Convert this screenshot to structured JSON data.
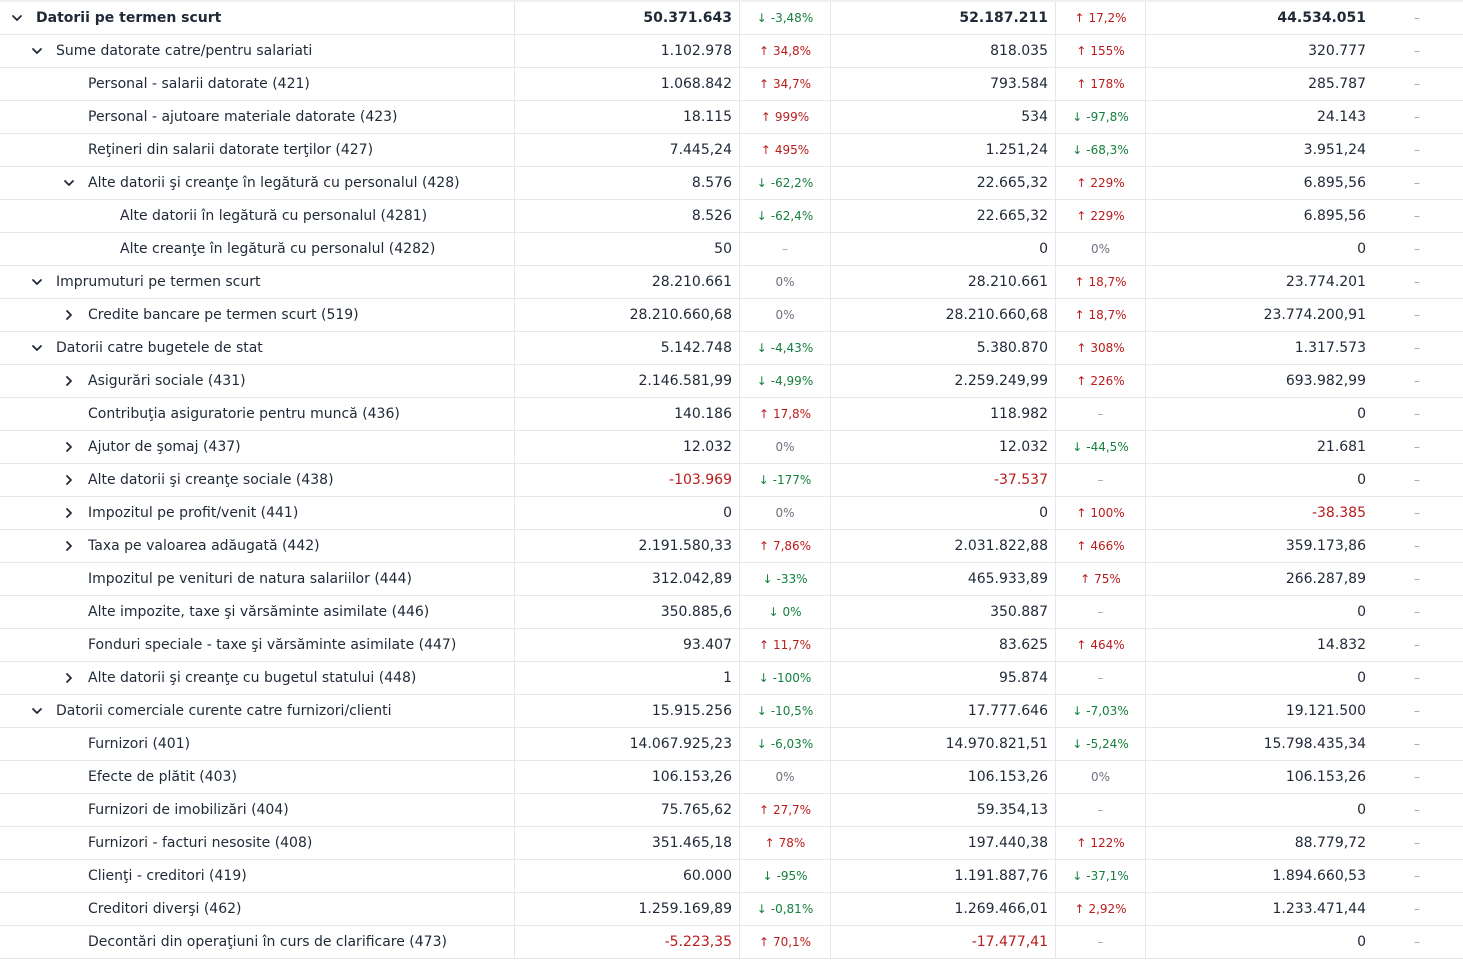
{
  "rows": [
    {
      "level": 0,
      "chevron": "chevron-down",
      "bold": true,
      "label": "Datorii pe termen scurt",
      "v1": "50.371.643",
      "d1": "-3,48%",
      "d1dir": "down",
      "v2": "52.187.211",
      "d2": "17,2%",
      "d2dir": "up",
      "v3": "44.534.051",
      "x": "–"
    },
    {
      "level": 1,
      "chevron": "chevron-down",
      "label": "Sume datorate catre/pentru salariati",
      "v1": "1.102.978",
      "d1": "34,8%",
      "d1dir": "up",
      "v2": "818.035",
      "d2": "155%",
      "d2dir": "up",
      "v3": "320.777",
      "x": "–"
    },
    {
      "level": 2,
      "chevron": "none",
      "label": "Personal - salarii datorate (421)",
      "v1": "1.068.842",
      "d1": "34,7%",
      "d1dir": "up",
      "v2": "793.584",
      "d2": "178%",
      "d2dir": "up",
      "v3": "285.787",
      "x": "–"
    },
    {
      "level": 2,
      "chevron": "none",
      "label": "Personal - ajutoare materiale datorate (423)",
      "v1": "18.115",
      "d1": "999%",
      "d1dir": "up",
      "v2": "534",
      "d2": "-97,8%",
      "d2dir": "down",
      "v3": "24.143",
      "x": "–"
    },
    {
      "level": 2,
      "chevron": "none",
      "label": "Reţineri din salarii datorate terţilor (427)",
      "v1": "7.445,24",
      "d1": "495%",
      "d1dir": "up",
      "v2": "1.251,24",
      "d2": "-68,3%",
      "d2dir": "down",
      "v3": "3.951,24",
      "x": "–"
    },
    {
      "level": 2,
      "chevron": "chevron-down",
      "label": "Alte datorii şi creanţe în legătură cu personalul (428)",
      "v1": "8.576",
      "d1": "-62,2%",
      "d1dir": "down",
      "v2": "22.665,32",
      "d2": "229%",
      "d2dir": "up",
      "v3": "6.895,56",
      "x": "–"
    },
    {
      "level": 3,
      "chevron": "none",
      "label": "Alte datorii în legătură cu personalul (4281)",
      "v1": "8.526",
      "d1": "-62,4%",
      "d1dir": "down",
      "v2": "22.665,32",
      "d2": "229%",
      "d2dir": "up",
      "v3": "6.895,56",
      "x": "–"
    },
    {
      "level": 3,
      "chevron": "none",
      "label": "Alte creanţe în legătură cu personalul (4282)",
      "v1": "50",
      "d1": "–",
      "d1dir": "dash",
      "v2": "0",
      "d2": "0%",
      "d2dir": "flat",
      "v3": "0",
      "x": "–"
    },
    {
      "level": 1,
      "chevron": "chevron-down",
      "label": "Imprumuturi pe termen scurt",
      "v1": "28.210.661",
      "d1": "0%",
      "d1dir": "flat",
      "v2": "28.210.661",
      "d2": "18,7%",
      "d2dir": "up",
      "v3": "23.774.201",
      "x": "–"
    },
    {
      "level": 2,
      "chevron": "chevron-right",
      "label": "Credite bancare pe termen scurt (519)",
      "v1": "28.210.660,68",
      "d1": "0%",
      "d1dir": "flat",
      "v2": "28.210.660,68",
      "d2": "18,7%",
      "d2dir": "up",
      "v3": "23.774.200,91",
      "x": "–"
    },
    {
      "level": 1,
      "chevron": "chevron-down",
      "label": "Datorii catre bugetele de stat",
      "v1": "5.142.748",
      "d1": "-4,43%",
      "d1dir": "down",
      "v2": "5.380.870",
      "d2": "308%",
      "d2dir": "up",
      "v3": "1.317.573",
      "x": "–"
    },
    {
      "level": 2,
      "chevron": "chevron-right",
      "label": "Asigurări sociale (431)",
      "v1": "2.146.581,99",
      "d1": "-4,99%",
      "d1dir": "down",
      "v2": "2.259.249,99",
      "d2": "226%",
      "d2dir": "up",
      "v3": "693.982,99",
      "x": "–"
    },
    {
      "level": 2,
      "chevron": "none",
      "label": "Contribuţia asiguratorie pentru muncă (436)",
      "v1": "140.186",
      "d1": "17,8%",
      "d1dir": "up",
      "v2": "118.982",
      "d2": "–",
      "d2dir": "dash",
      "v3": "0",
      "x": "–"
    },
    {
      "level": 2,
      "chevron": "chevron-right",
      "label": "Ajutor de şomaj (437)",
      "v1": "12.032",
      "d1": "0%",
      "d1dir": "flat",
      "v2": "12.032",
      "d2": "-44,5%",
      "d2dir": "down",
      "v3": "21.681",
      "x": "–"
    },
    {
      "level": 2,
      "chevron": "chevron-right",
      "label": "Alte datorii şi creanţe sociale (438)",
      "v1": "-103.969",
      "v1neg": true,
      "d1": "-177%",
      "d1dir": "down",
      "v2": "-37.537",
      "v2neg": true,
      "d2": "–",
      "d2dir": "dash",
      "v3": "0",
      "x": "–"
    },
    {
      "level": 2,
      "chevron": "chevron-right",
      "label": "Impozitul pe profit/venit (441)",
      "v1": "0",
      "d1": "0%",
      "d1dir": "flat",
      "v2": "0",
      "d2": "100%",
      "d2dir": "up",
      "v3": "-38.385",
      "v3neg": true,
      "x": "–"
    },
    {
      "level": 2,
      "chevron": "chevron-right",
      "label": "Taxa pe valoarea adăugată (442)",
      "v1": "2.191.580,33",
      "d1": "7,86%",
      "d1dir": "up",
      "v2": "2.031.822,88",
      "d2": "466%",
      "d2dir": "up",
      "v3": "359.173,86",
      "x": "–"
    },
    {
      "level": 2,
      "chevron": "none",
      "label": "Impozitul pe venituri de natura salariilor (444)",
      "v1": "312.042,89",
      "d1": "-33%",
      "d1dir": "down",
      "v2": "465.933,89",
      "d2": "75%",
      "d2dir": "up",
      "v3": "266.287,89",
      "x": "–"
    },
    {
      "level": 2,
      "chevron": "none",
      "label": "Alte impozite, taxe şi vărsăminte asimilate (446)",
      "v1": "350.885,6",
      "d1": "0%",
      "d1dir": "down",
      "v2": "350.887",
      "d2": "–",
      "d2dir": "dash",
      "v3": "0",
      "x": "–"
    },
    {
      "level": 2,
      "chevron": "none",
      "label": "Fonduri speciale - taxe şi vărsăminte asimilate (447)",
      "v1": "93.407",
      "d1": "11,7%",
      "d1dir": "up",
      "v2": "83.625",
      "d2": "464%",
      "d2dir": "up",
      "v3": "14.832",
      "x": "–"
    },
    {
      "level": 2,
      "chevron": "chevron-right",
      "label": "Alte datorii şi creanţe cu bugetul statului (448)",
      "v1": "1",
      "d1": "-100%",
      "d1dir": "down",
      "v2": "95.874",
      "d2": "–",
      "d2dir": "dash",
      "v3": "0",
      "x": "–"
    },
    {
      "level": 1,
      "chevron": "chevron-down",
      "label": "Datorii comerciale curente catre furnizori/clienti",
      "v1": "15.915.256",
      "d1": "-10,5%",
      "d1dir": "down",
      "v2": "17.777.646",
      "d2": "-7,03%",
      "d2dir": "down",
      "v3": "19.121.500",
      "x": "–"
    },
    {
      "level": 2,
      "chevron": "none",
      "label": "Furnizori (401)",
      "v1": "14.067.925,23",
      "d1": "-6,03%",
      "d1dir": "down",
      "v2": "14.970.821,51",
      "d2": "-5,24%",
      "d2dir": "down",
      "v3": "15.798.435,34",
      "x": "–"
    },
    {
      "level": 2,
      "chevron": "none",
      "label": "Efecte de plătit (403)",
      "v1": "106.153,26",
      "d1": "0%",
      "d1dir": "flat",
      "v2": "106.153,26",
      "d2": "0%",
      "d2dir": "flat",
      "v3": "106.153,26",
      "x": "–"
    },
    {
      "level": 2,
      "chevron": "none",
      "label": "Furnizori de imobilizări (404)",
      "v1": "75.765,62",
      "d1": "27,7%",
      "d1dir": "up",
      "v2": "59.354,13",
      "d2": "–",
      "d2dir": "dash",
      "v3": "0",
      "x": "–"
    },
    {
      "level": 2,
      "chevron": "none",
      "label": "Furnizori - facturi nesosite (408)",
      "v1": "351.465,18",
      "d1": "78%",
      "d1dir": "up",
      "v2": "197.440,38",
      "d2": "122%",
      "d2dir": "up",
      "v3": "88.779,72",
      "x": "–"
    },
    {
      "level": 2,
      "chevron": "none",
      "label": "Clienţi - creditori (419)",
      "v1": "60.000",
      "d1": "-95%",
      "d1dir": "down",
      "v2": "1.191.887,76",
      "d2": "-37,1%",
      "d2dir": "down",
      "v3": "1.894.660,53",
      "x": "–"
    },
    {
      "level": 2,
      "chevron": "none",
      "label": "Creditori diverşi (462)",
      "v1": "1.259.169,89",
      "d1": "-0,81%",
      "d1dir": "down",
      "v2": "1.269.466,01",
      "d2": "2,92%",
      "d2dir": "up",
      "v3": "1.233.471,44",
      "x": "–"
    },
    {
      "level": 2,
      "chevron": "none",
      "label": "Decontări din operaţiuni în curs de clarificare (473)",
      "v1": "-5.223,35",
      "v1neg": true,
      "d1": "70,1%",
      "d1dir": "up",
      "v2": "-17.477,41",
      "v2neg": true,
      "d2": "–",
      "d2dir": "dash",
      "v3": "0",
      "x": "–"
    }
  ]
}
